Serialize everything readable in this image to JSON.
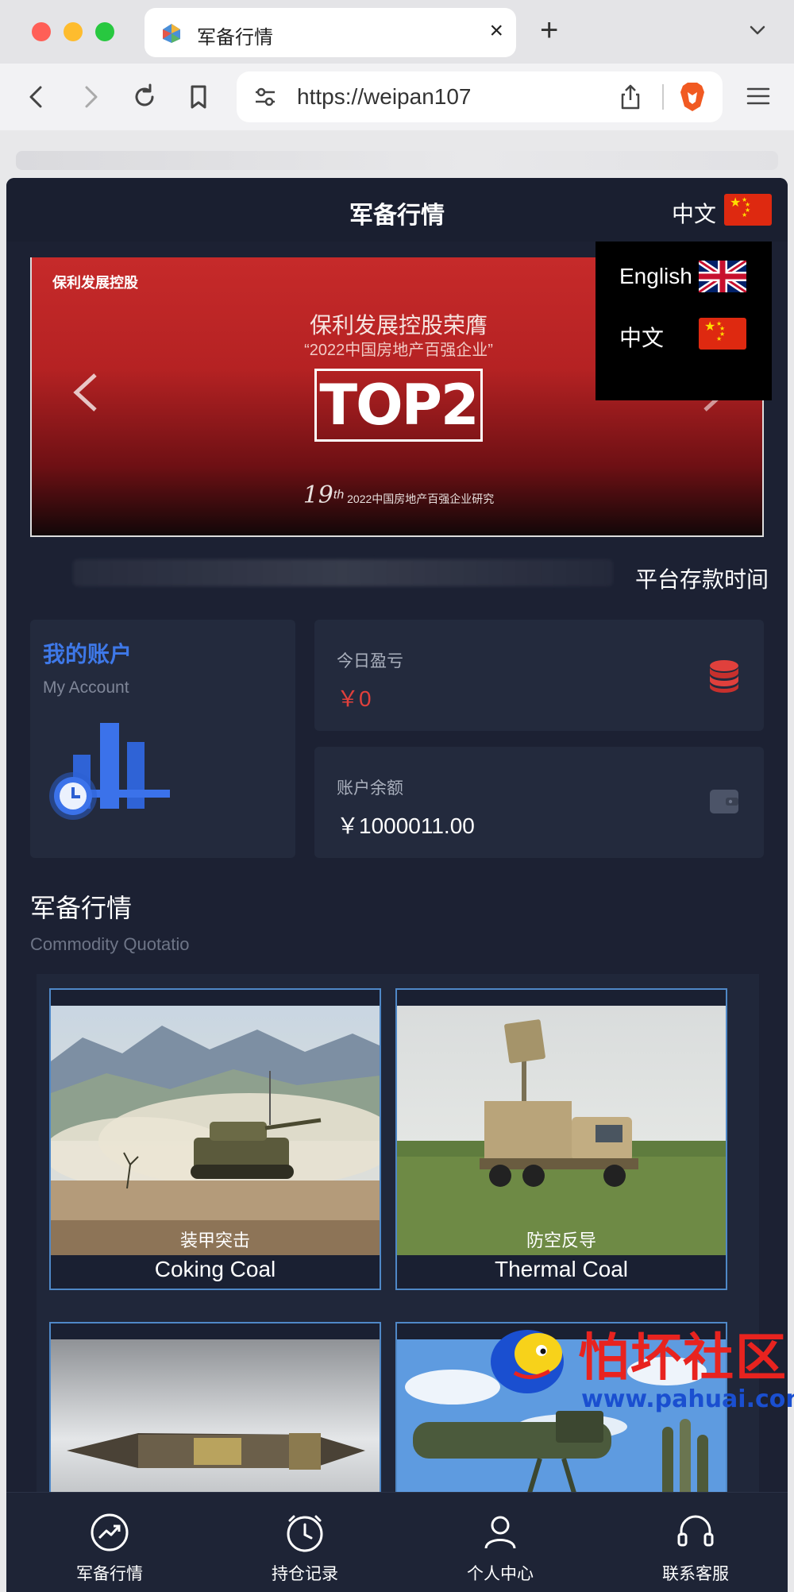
{
  "browser": {
    "tab_title": "军备行情",
    "url": "https://weipan107",
    "close_glyph": "×",
    "new_tab_glyph": "+"
  },
  "app": {
    "title": "军备行情",
    "current_language": "中文",
    "languages": [
      {
        "label": "English",
        "flag": "uk-flag"
      },
      {
        "label": "中文",
        "flag": "cn-flag"
      }
    ]
  },
  "banner": {
    "logo": "保利发展控股",
    "headline": "保利发展控股荣膺",
    "subheadline": "“2022中国房地产百强企业”",
    "badge": "TOP2",
    "footer_number": "19",
    "footer_sup": "th",
    "footer_text": "2022中国房地产百强企业研究"
  },
  "marquee": "平台存款时间",
  "account": {
    "title": "我的账户",
    "subtitle": "My Account"
  },
  "stats": [
    {
      "label": "今日盈亏",
      "value": "￥0",
      "icon": "coins-icon"
    },
    {
      "label": "账户余额",
      "value": "￥1000011.00",
      "icon": "wallet-icon"
    }
  ],
  "section": {
    "title": "军备行情",
    "subtitle": "Commodity Quotatio"
  },
  "products": [
    {
      "cn": "装甲突击",
      "en": "Coking Coal"
    },
    {
      "cn": "防空反导",
      "en": "Thermal Coal"
    },
    {
      "cn": "",
      "en": ""
    },
    {
      "cn": "",
      "en": ""
    }
  ],
  "nav": [
    {
      "label": "军备行情",
      "icon": "trend-icon"
    },
    {
      "label": "持仓记录",
      "icon": "clock-icon"
    },
    {
      "label": "个人中心",
      "icon": "user-icon"
    },
    {
      "label": "联系客服",
      "icon": "headset-icon"
    }
  ],
  "watermark": {
    "text": "怕坏社区",
    "url": "www.pahuai.com"
  },
  "colors": {
    "app_bg": "#1c2133",
    "card_bg": "#232a3d",
    "accent_blue": "#3e78e8",
    "loss_red": "#e0403c",
    "product_border": "#4f88c7"
  }
}
